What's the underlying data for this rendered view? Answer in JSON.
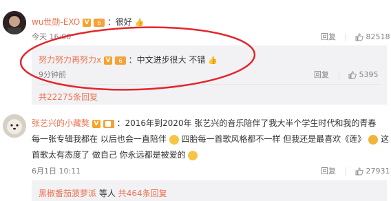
{
  "comment1": {
    "username": "wu世勋-EXO",
    "text": "：很好",
    "time": "今天 16:00",
    "reply_label": "回复",
    "likes": "82518"
  },
  "reply1": {
    "username": "努力努力再努力x",
    "text": "：中文进步很大 不错",
    "time": "9分钟前",
    "reply_label": "回复",
    "likes": "5395"
  },
  "more1": {
    "text": "共22275条回复"
  },
  "comment2": {
    "username": "张艺兴的小藏獒",
    "text_line1": "：2016年到2020年 张艺兴的音乐陪伴了我大半个学生时代和我的青春",
    "text_line2a": "每一张专辑我都在 以后也会一直陪伴",
    "text_line2b": "四胎每一首歌风格都不一样 但我还是最喜欢《莲》",
    "text_line2c": "这",
    "text_line3": "首歌太有态度了 做自己 你永远都是被爱的",
    "time": "6月1日 10:11",
    "reply_label": "回复",
    "likes": "27931"
  },
  "more2": {
    "user": "黑椒番茄菠萝派",
    "middle": "等人",
    "count": "共464条回复"
  },
  "colors": {
    "accent": "#eb7350",
    "annotation": "#e3262b"
  }
}
